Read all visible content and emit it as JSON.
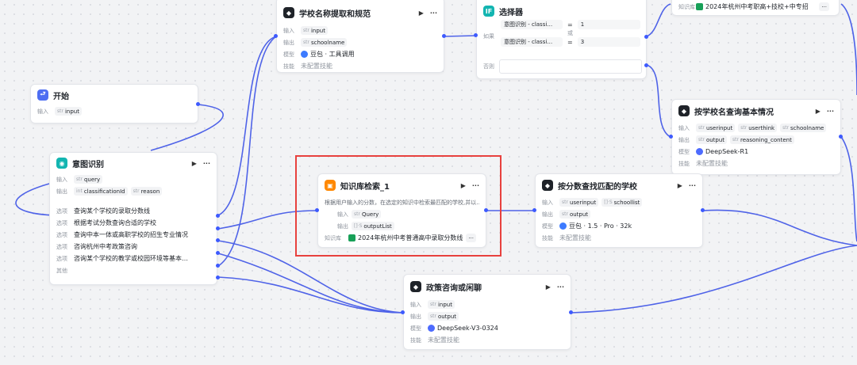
{
  "labels": {
    "input": "输入",
    "output": "输出",
    "model": "模型",
    "skill": "技能",
    "option": "选项",
    "other": "其他",
    "kb": "知识库",
    "if": "如果",
    "else": "否则",
    "or": "或"
  },
  "type_str": "str",
  "type_list": "[]·S",
  "more": "···",
  "run": "▶",
  "start": {
    "title": "开始",
    "input": "input"
  },
  "intent": {
    "title": "意图识别",
    "input": "query",
    "outputs": [
      "classificationId",
      "reason"
    ],
    "output_type": "int",
    "options": [
      "查询某个学校的录取分数线",
      "根据考试分数查询合适的学校",
      "查询中本一体或高职学校的招生专业情况",
      "咨询杭州中考政策咨询",
      "咨询某个学校的教学或校园环境等基本…"
    ]
  },
  "extract": {
    "title": "学校名称提取和规范",
    "input": "input",
    "output": "schoolname",
    "model": "豆包 · 工具调用",
    "skill": "未配置技能"
  },
  "selector": {
    "title": "选择器",
    "cond1_var": "意图识别 - classi…",
    "cond1_op": "=",
    "cond1_val": "1",
    "cond2_var": "意图识别 - classi…",
    "cond2_op": "=",
    "cond2_val": "3"
  },
  "topkb": {
    "kb": "2024年杭州中考职高+技校+中专招"
  },
  "kbsearch": {
    "title": "知识库检索_1",
    "desc": "根据用户输入的分数，在选定的知识中检索最匹配的学校,并以…",
    "input": "Query",
    "output": "outputList",
    "kb": "2024年杭州中考普通高中录取分数线"
  },
  "score": {
    "title": "按分数查找匹配的学校",
    "inputs": [
      "userinput",
      "schoollist"
    ],
    "output": "output",
    "model": "豆包 · 1.5 · Pro · 32k",
    "skill": "未配置技能"
  },
  "basic": {
    "title": "按学校名查询基本情况",
    "inputs": [
      "userinput",
      "userthink",
      "schoolname"
    ],
    "outputs": [
      "output",
      "reasoning_content"
    ],
    "model": "DeepSeek-R1",
    "skill": "未配置技能"
  },
  "policy": {
    "title": "政策咨询或闲聊",
    "input": "input",
    "output": "output",
    "model": "DeepSeek-V3-0324",
    "skill": "未配置技能"
  }
}
